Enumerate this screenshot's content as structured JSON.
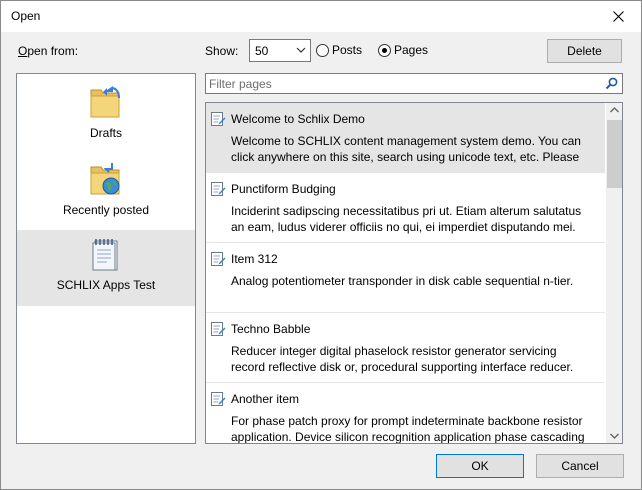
{
  "window": {
    "title": "Open"
  },
  "toolbar": {
    "open_from_label": "Open from:",
    "show_label": "Show:",
    "show_value": "50",
    "radio_posts": "Posts",
    "radio_pages": "Pages",
    "selected_radio": "Pages",
    "delete_label": "Delete"
  },
  "places": [
    {
      "label": "Drafts",
      "icon": "folder-arrow-icon"
    },
    {
      "label": "Recently posted",
      "icon": "folder-globe-icon"
    },
    {
      "label": "SCHLIX Apps Test",
      "icon": "notepad-icon",
      "selected": true
    }
  ],
  "filter": {
    "placeholder": "Filter pages"
  },
  "items": [
    {
      "title": "Welcome to Schlix Demo",
      "desc": "Welcome to SCHLIX content management system demo. You can click anywhere on this site, search using unicode text, etc. Please",
      "selected": true
    },
    {
      "title": "Punctiform Budging",
      "desc": "Inciderint sadipscing necessitatibus pri ut. Etiam alterum salutatus an eam, ludus viderer officiis no qui, ei imperdiet disputando mei."
    },
    {
      "title": "Item 312",
      "desc": "Analog potentiometer transponder in disk cable sequential n-tier."
    },
    {
      "title": "Techno Babble",
      "desc": "Reducer integer digital phaselock resistor generator servicing record reflective disk or, procedural supporting interface reducer. Reducer"
    },
    {
      "title": "Another item",
      "desc": "For phase patch proxy for prompt indeterminate backbone resistor application. Device silicon recognition application phase cascading"
    }
  ],
  "footer": {
    "ok_label": "OK",
    "cancel_label": "Cancel"
  }
}
